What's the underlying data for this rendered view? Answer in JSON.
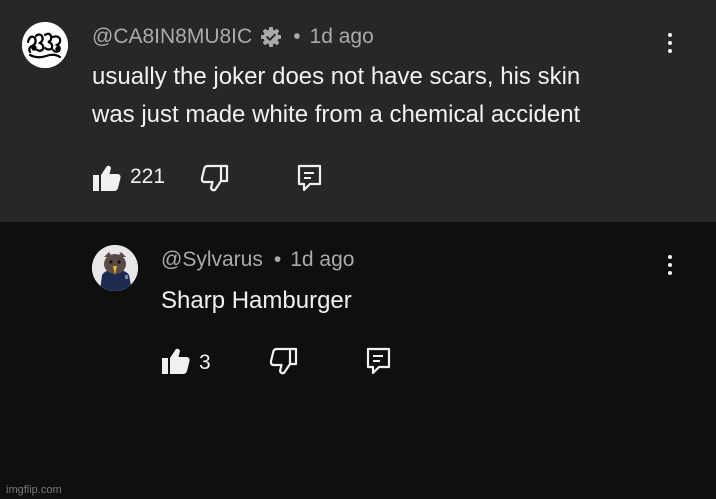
{
  "comments": [
    {
      "handle": "@CA8IN8MU8IC",
      "verified": true,
      "separator": "•",
      "time": "1d ago",
      "text_lines": [
        "usually the joker does not have scars, his skin",
        "was just made white from a chemical accident"
      ],
      "likes": "221",
      "icons": [
        "avatar-graffiti",
        "verified-gear-icon",
        "thumbs-up-icon",
        "thumbs-down-icon",
        "reply-icon",
        "more-vert-icon"
      ]
    },
    {
      "handle": "@Sylvarus",
      "verified": false,
      "separator": "•",
      "time": "1d ago",
      "text": "Sharp Hamburger",
      "likes": "3",
      "icons": [
        "avatar-bird",
        "thumbs-up-icon",
        "thumbs-down-icon",
        "reply-icon",
        "more-vert-icon"
      ]
    }
  ],
  "watermark": "imgflip.com",
  "colors": {
    "top_background": "#272727",
    "reply_background": "#0f0f0f",
    "primary_text": "#f1f1f1",
    "secondary_text": "#aaaaaa"
  }
}
